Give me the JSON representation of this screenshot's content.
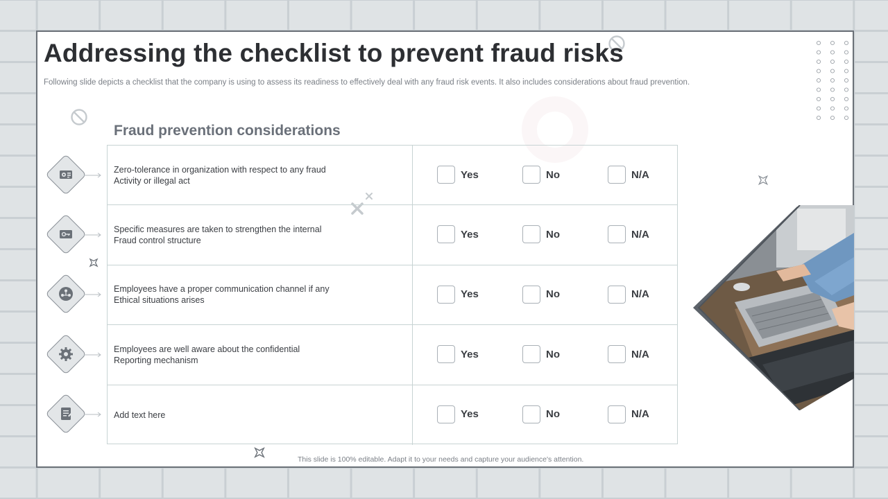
{
  "slide": {
    "title": "Addressing the checklist to prevent fraud risks",
    "subtitle": "Following slide depicts a checklist that the company is using to assess its readiness to effectively deal with any fraud risk events. It also includes considerations about fraud prevention.",
    "section_heading": "Fraud prevention  considerations",
    "footer": "This slide is 100% editable. Adapt it to your needs and capture your audience's attention."
  },
  "options": {
    "yes": "Yes",
    "no": "No",
    "na": "N/A"
  },
  "rows": [
    {
      "icon": "settings-dashboard-icon",
      "text": "Zero-tolerance  in organization with respect to any fraud\nActivity or illegal act"
    },
    {
      "icon": "key-card-icon",
      "text": "Specific measures are taken to strengthen the internal\nFraud control structure"
    },
    {
      "icon": "communication-network-icon",
      "text": "Employees have  a proper communication channel if any\nEthical situations arises"
    },
    {
      "icon": "gear-icon",
      "text": "Employees are well aware about the confidential\nReporting mechanism"
    },
    {
      "icon": "document-icon",
      "text": "Add text here"
    }
  ],
  "colors": {
    "accent": "#6a7079",
    "border": "#c7d3d3",
    "background_tile": "#dfe3e5"
  }
}
